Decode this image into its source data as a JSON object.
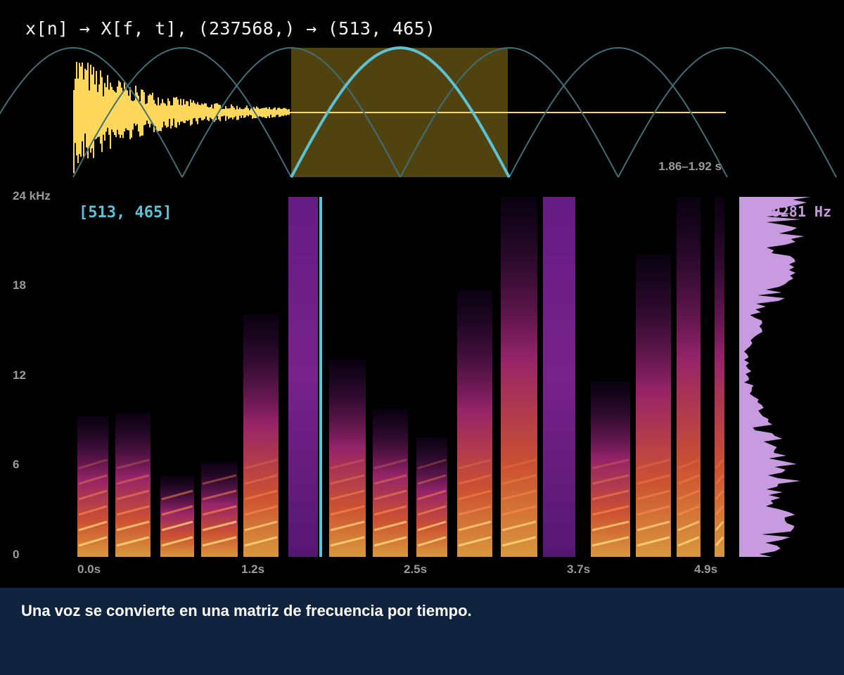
{
  "header": {
    "formula": "x[n] → X[f, t], (237568,) → (513, 465)"
  },
  "waveform": {
    "window_time_label": "1.86–1.92 s"
  },
  "spectrogram": {
    "cursor_label": "[513, 465]",
    "freq_readout": "9281 Hz",
    "freq_axis_labels": [
      "24 kHz",
      "18",
      "12",
      "6",
      "0"
    ],
    "time_axis_labels": [
      "0.0s",
      "1.2s",
      "2.5s",
      "3.7s",
      "4.9s"
    ]
  },
  "colors": {
    "waveform": "#ffd75a",
    "window_fill": "#6b5a14",
    "window_line": "#5cc3d6",
    "spectrum": "#c89be0",
    "caption_band": "#10243f"
  },
  "caption": {
    "text": "Una voz se convierte en una matriz de frecuencia por tiempo."
  }
}
